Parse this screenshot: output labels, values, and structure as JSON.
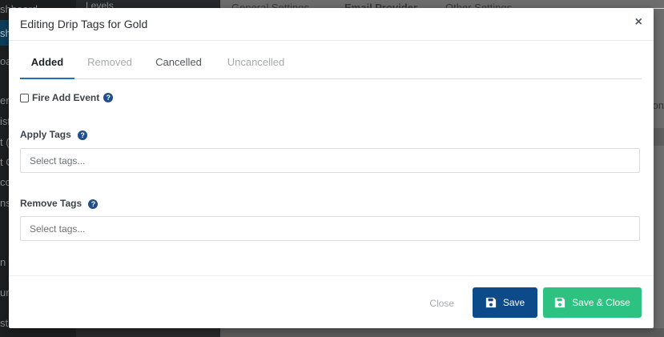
{
  "background": {
    "sidebar_items": [
      "shboard",
      "sh",
      "oa",
      "ers",
      "ist",
      "t (",
      "t C",
      "cce",
      "ns",
      "n T",
      "un",
      "st"
    ],
    "submenu_item": "Levels",
    "tabs": [
      "General Settings",
      "Email Provider",
      "Other Settings"
    ],
    "right_fragment": "on"
  },
  "modal": {
    "title": "Editing Drip Tags for Gold",
    "close_symbol": "×",
    "tabs": [
      {
        "label": "Added",
        "state": "active"
      },
      {
        "label": "Removed",
        "state": "disabled"
      },
      {
        "label": "Cancelled",
        "state": "normal"
      },
      {
        "label": "Uncancelled",
        "state": "disabled"
      }
    ],
    "fire_add_event": {
      "label": "Fire Add Event",
      "checked": false
    },
    "apply_tags": {
      "label": "Apply Tags",
      "placeholder": "Select tags..."
    },
    "remove_tags": {
      "label": "Remove Tags",
      "placeholder": "Select tags..."
    },
    "help_symbol": "?",
    "footer": {
      "close_label": "Close",
      "save_label": "Save",
      "save_close_label": "Save & Close"
    }
  },
  "colors": {
    "primary": "#0d4a8a",
    "success": "#2ec282",
    "help_icon": "#1e4e8c",
    "tab_active_underline": "#2271b1"
  },
  "icons": {
    "close": "close-icon",
    "help": "help-icon",
    "save": "floppy-disk-icon"
  }
}
